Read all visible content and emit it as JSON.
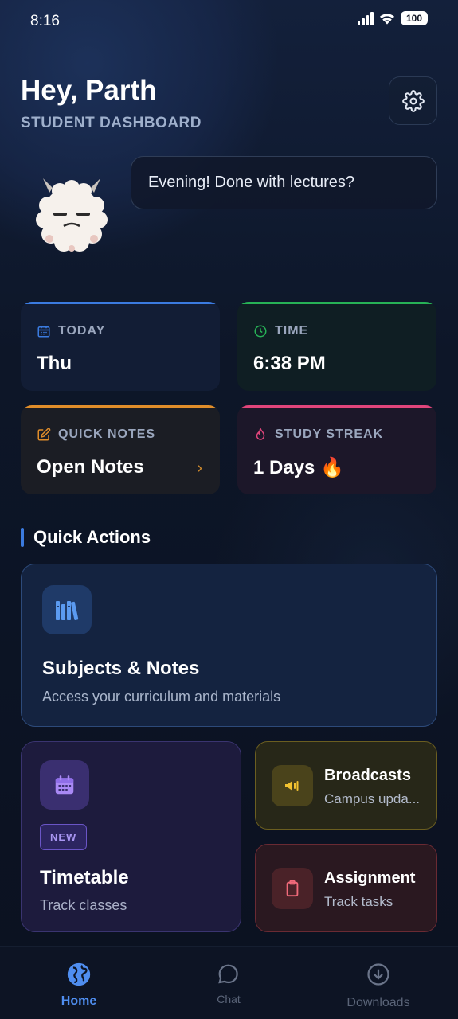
{
  "status_bar": {
    "time": "8:16",
    "battery": "100"
  },
  "header": {
    "greeting": "Hey, Parth",
    "subtitle": "STUDENT DASHBOARD"
  },
  "speech_bubble": "Evening! Done with lectures?",
  "cards": {
    "today": {
      "label": "TODAY",
      "value": "Thu",
      "accent": "#3b7be0"
    },
    "time": {
      "label": "TIME",
      "value": "6:38 PM",
      "accent": "#27b256"
    },
    "notes": {
      "label": "QUICK NOTES",
      "value": "Open Notes",
      "accent": "#e08d2a"
    },
    "streak": {
      "label": "STUDY STREAK",
      "value": "1 Days 🔥",
      "accent": "#e0457b"
    }
  },
  "quick_actions": {
    "title": "Quick Actions",
    "subjects": {
      "title": "Subjects & Notes",
      "desc": "Access your curriculum and materials"
    },
    "timetable": {
      "badge": "NEW",
      "title": "Timetable",
      "desc": "Track classes"
    },
    "broadcasts": {
      "title": "Broadcasts",
      "desc": "Campus upda..."
    },
    "assignment": {
      "title": "Assignment",
      "desc": "Track tasks"
    }
  },
  "nav": {
    "home": "Home",
    "chat": "Chat",
    "downloads": "Downloads"
  }
}
